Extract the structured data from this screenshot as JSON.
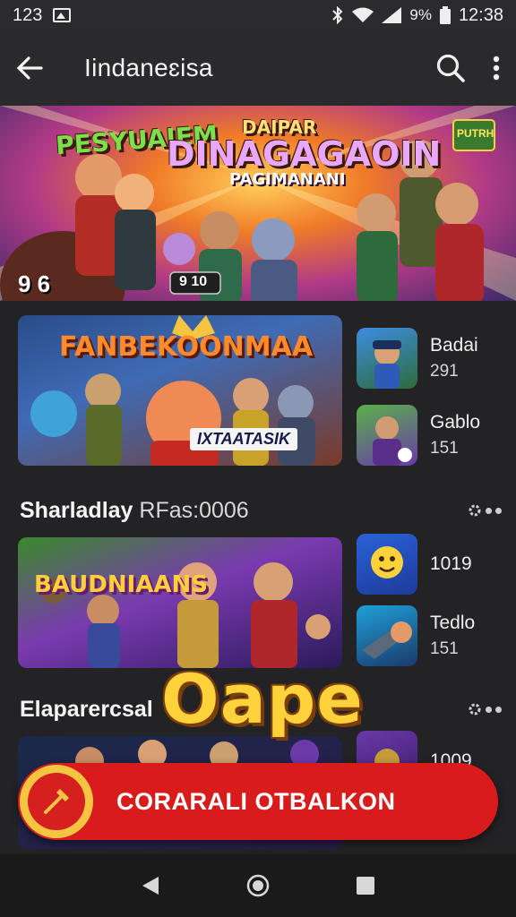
{
  "status_bar": {
    "time_left": "123",
    "battery": "%",
    "battery_digits": "9",
    "clock": "12:38"
  },
  "app_bar": {
    "title": "Iindaneɛisa",
    "back_icon": "back-arrow-icon",
    "search_icon": "search-icon",
    "more_icon": "more-vert-icon"
  },
  "hero": {
    "tag_left": "PESYUAIEM",
    "tag_top": "DAIPAR",
    "headline": "DINAGAGAOIN",
    "subline": "PAGIMANANI",
    "corner_badge": "PUTRH",
    "counter": "9 6",
    "pill": "9 10"
  },
  "featured": {
    "banner_title": "FANBEKOONMAA",
    "banner_sub": "IXTAATASIK",
    "side_items": [
      {
        "name": "Badai",
        "value": "291"
      },
      {
        "name": "Gablo",
        "value": "151"
      }
    ]
  },
  "section1": {
    "title": "Sharladlay",
    "subtitle": "RFas:0006",
    "banner_title": "BAUDNIAANS",
    "side_items": [
      {
        "name": "1019",
        "value": ""
      },
      {
        "name": "Tedlo",
        "value": "151"
      }
    ]
  },
  "section2": {
    "title": "Elaparercsal",
    "big_word": "Oape",
    "side_items": [
      {
        "name": "1009",
        "value": ""
      }
    ]
  },
  "cta": {
    "label": "CORARALI OTBALKON"
  },
  "colors": {
    "background": "#232325",
    "app_bar": "#2a2a2c",
    "cta_red": "#d81c1c",
    "cta_icon_ring": "#f5c542",
    "accent_yellow": "#ffd13a"
  }
}
